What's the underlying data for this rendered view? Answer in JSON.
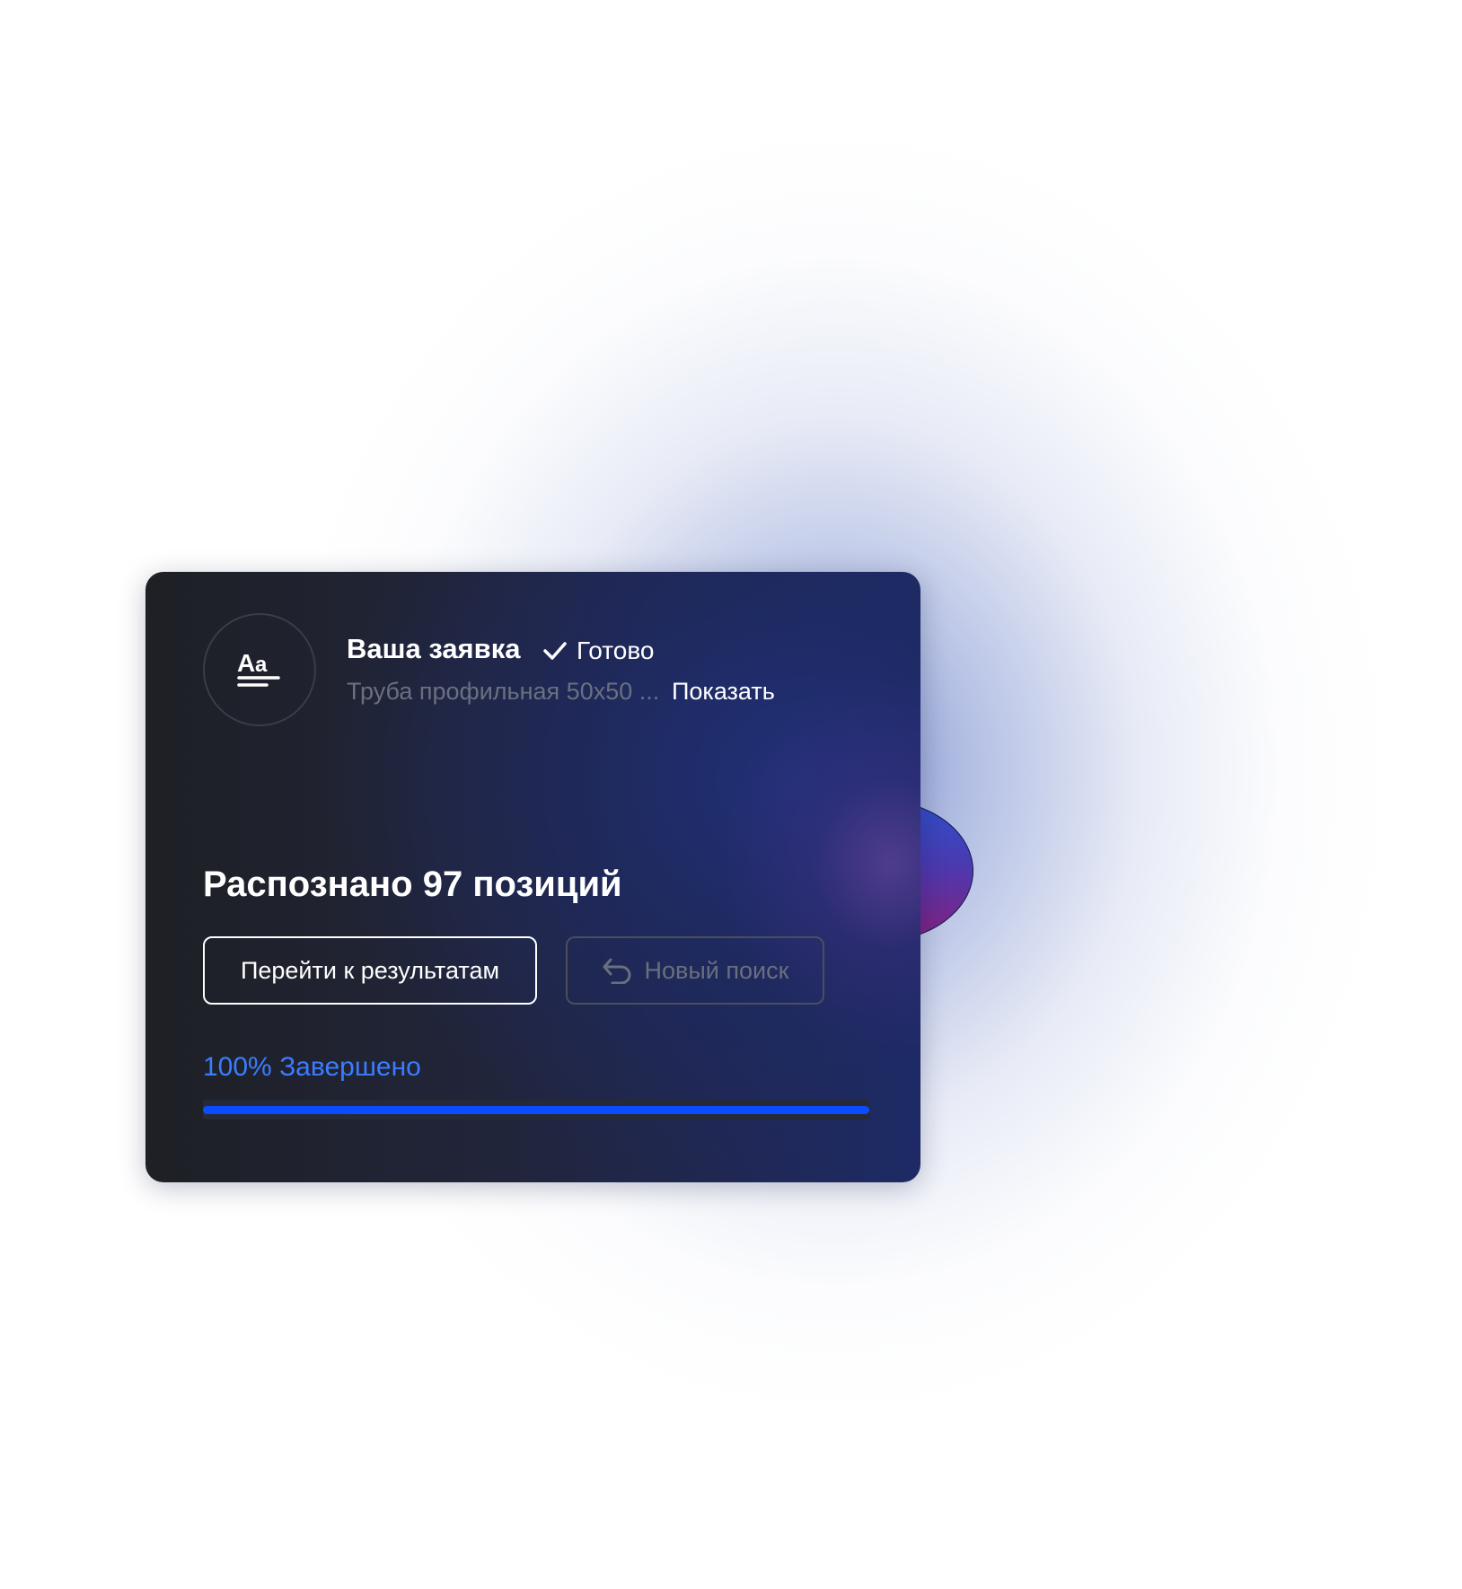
{
  "request": {
    "avatar_icon": "text-format-icon",
    "title": "Ваша заявка",
    "status_icon": "check-icon",
    "status": "Готово",
    "description": "Труба профильная 50x50 ...",
    "show_link": "Показать"
  },
  "result": {
    "recognized_text": "Распознано 97 позиций"
  },
  "actions": {
    "primary_label": "Перейти к результатам",
    "secondary_icon": "undo-icon",
    "secondary_label": "Новый поиск"
  },
  "progress": {
    "label": "100% Завершено",
    "value": 1.0
  },
  "colors": {
    "accent": "#0a4cff",
    "progress_text": "#3b7cff",
    "card_dark": "#1e2025",
    "card_blue": "#1e2a66"
  }
}
